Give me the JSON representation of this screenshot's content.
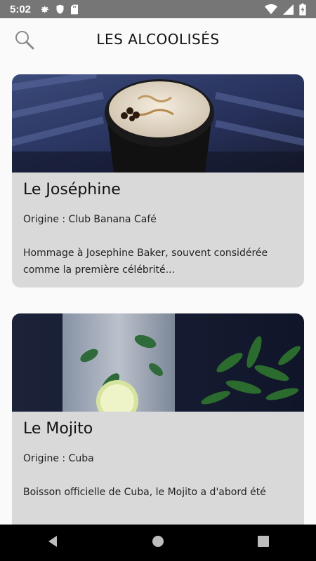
{
  "status_bar": {
    "time": "5:02",
    "icons": [
      "settings-icon",
      "shield-icon",
      "sd-card-icon",
      "wifi-icon",
      "signal-icon",
      "battery-icon"
    ]
  },
  "header": {
    "title": "LES ALCOOLISÉS",
    "search_icon": "search-icon"
  },
  "cocktails": [
    {
      "title": "Le Joséphine",
      "origin": "Origine : Club Banana Café",
      "description": "Hommage à Josephine Baker, souvent considérée comme la première célébrité..."
    },
    {
      "title": "Le Mojito",
      "origin": "Origine : Cuba",
      "description": "Boisson officielle de Cuba, le Mojito a d'abord été"
    }
  ],
  "colors": {
    "status_bar": "#767676",
    "background": "#fafafa",
    "card": "#d9d9d9",
    "nav_bar": "#000000"
  },
  "nav_bar": {
    "buttons": [
      "back-icon",
      "home-icon",
      "recents-icon"
    ]
  }
}
